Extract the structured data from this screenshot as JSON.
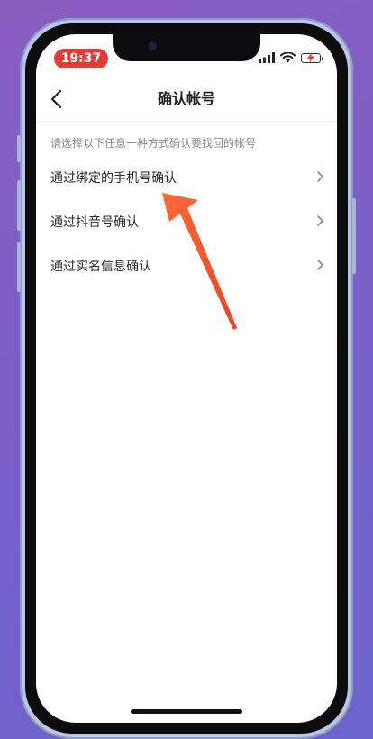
{
  "status_bar": {
    "time": "19:37"
  },
  "nav": {
    "title": "确认帐号"
  },
  "hint": "请选择以下任意一种方式确认要找回的帐号",
  "options": [
    {
      "label": "通过绑定的手机号确认"
    },
    {
      "label": "通过抖音号确认"
    },
    {
      "label": "通过实名信息确认"
    }
  ],
  "colors": {
    "time_pill": "#e53a35",
    "annotation_arrow": "#f0542d"
  },
  "icons": {
    "back": "chevron-left-icon",
    "row": "chevron-right-icon"
  }
}
